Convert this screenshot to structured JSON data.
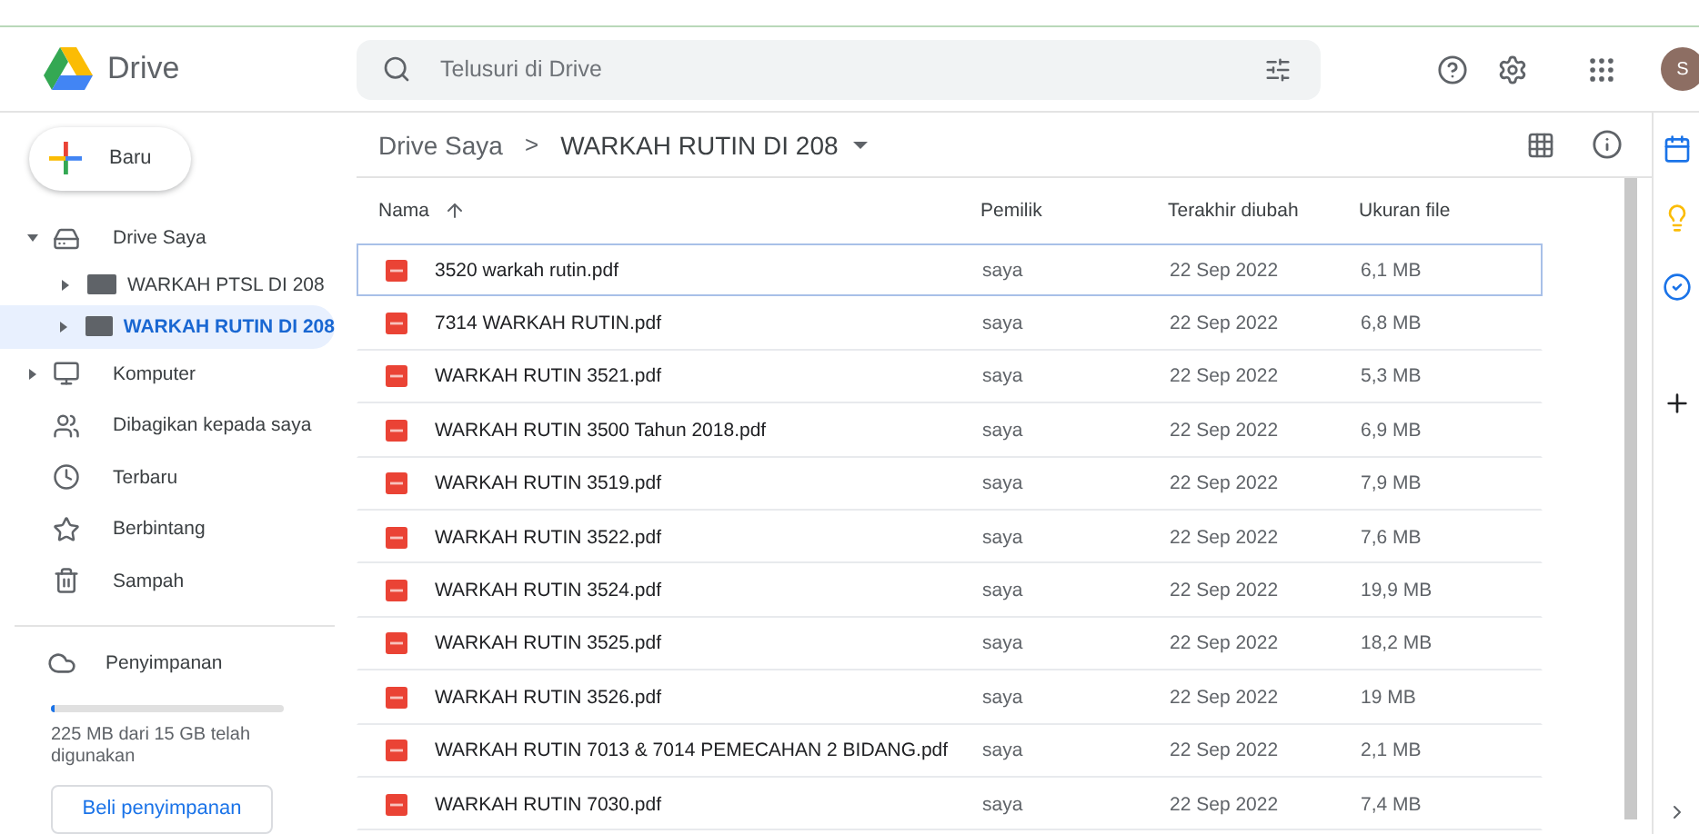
{
  "app": {
    "name": "Drive"
  },
  "search": {
    "placeholder": "Telusuri di Drive"
  },
  "account": {
    "initial": "S"
  },
  "new_button": {
    "label": "Baru"
  },
  "nav": [
    {
      "label": "Drive Saya",
      "expanded": true,
      "selected": false,
      "children": [
        {
          "label": "WARKAH PTSL DI 208",
          "expanded": false,
          "selected": false
        },
        {
          "label": "WARKAH RUTIN DI 208",
          "expanded": false,
          "selected": true
        }
      ]
    },
    {
      "label": "Komputer",
      "expanded": false,
      "selected": false
    },
    {
      "label": "Dibagikan kepada saya",
      "selected": false
    },
    {
      "label": "Terbaru",
      "selected": false
    },
    {
      "label": "Berbintang",
      "selected": false
    },
    {
      "label": "Sampah",
      "selected": false
    }
  ],
  "storage": {
    "label": "Penyimpanan",
    "level": 0.015,
    "usage": "225 MB dari 15 GB telah digunakan",
    "button": "Beli penyimpanan"
  },
  "breadcrumb": {
    "root": "Drive Saya",
    "separator": ">",
    "current": "WARKAH RUTIN DI 208"
  },
  "table": {
    "columns": [
      "Nama",
      "Pemilik",
      "Terakhir diubah",
      "Ukuran file"
    ],
    "rows": [
      {
        "name": "3520 warkah rutin.pdf",
        "owner": "saya",
        "modified": "22 Sep 2022",
        "size": "6,1 MB",
        "selected": true
      },
      {
        "name": "7314 WARKAH RUTIN.pdf",
        "owner": "saya",
        "modified": "22 Sep 2022",
        "size": "6,8 MB",
        "selected": false
      },
      {
        "name": "WARKAH RUTIN  3521.pdf",
        "owner": "saya",
        "modified": "22 Sep 2022",
        "size": "5,3 MB",
        "selected": false
      },
      {
        "name": "WARKAH RUTIN 3500 Tahun 2018.pdf",
        "owner": "saya",
        "modified": "22 Sep 2022",
        "size": "6,9 MB",
        "selected": false
      },
      {
        "name": "WARKAH RUTIN 3519.pdf",
        "owner": "saya",
        "modified": "22 Sep 2022",
        "size": "7,9 MB",
        "selected": false
      },
      {
        "name": "WARKAH RUTIN 3522.pdf",
        "owner": "saya",
        "modified": "22 Sep 2022",
        "size": "7,6 MB",
        "selected": false
      },
      {
        "name": "WARKAH RUTIN 3524.pdf",
        "owner": "saya",
        "modified": "22 Sep 2022",
        "size": "19,9 MB",
        "selected": false
      },
      {
        "name": "WARKAH RUTIN 3525.pdf",
        "owner": "saya",
        "modified": "22 Sep 2022",
        "size": "18,2 MB",
        "selected": false
      },
      {
        "name": "WARKAH RUTIN 3526.pdf",
        "owner": "saya",
        "modified": "22 Sep 2022",
        "size": "19 MB",
        "selected": false
      },
      {
        "name": "WARKAH RUTIN 7013 & 7014 PEMECAHAN 2 BIDANG.pdf",
        "owner": "saya",
        "modified": "22 Sep 2022",
        "size": "2,1 MB",
        "selected": false
      },
      {
        "name": "WARKAH RUTIN 7030.pdf",
        "owner": "saya",
        "modified": "22 Sep 2022",
        "size": "7,4 MB",
        "selected": false
      }
    ]
  }
}
